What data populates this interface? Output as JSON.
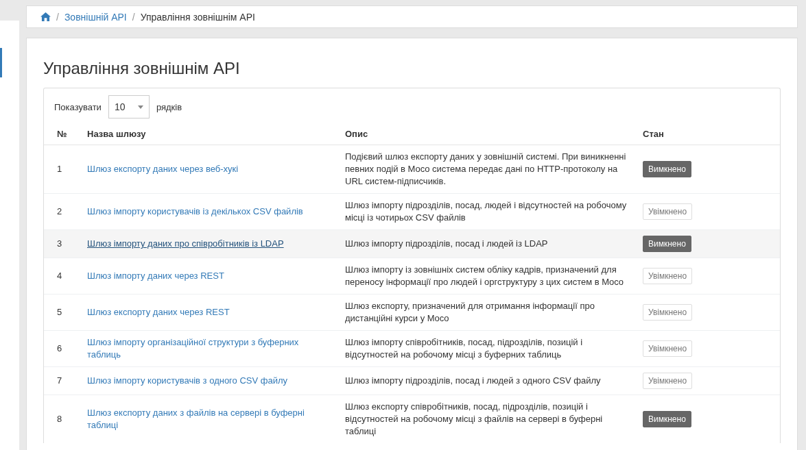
{
  "breadcrumb": [
    {
      "separator": "/",
      "label": "Зовнішній API",
      "link": true
    },
    {
      "separator": "/",
      "label": "Управління зовнішнім API",
      "link": false
    }
  ],
  "page_title": "Управління зовнішнім API",
  "page_size": {
    "label_before": "Показувати",
    "value": "10",
    "label_after": "рядків"
  },
  "table": {
    "columns": [
      "№",
      "Назва шлюзу",
      "Опис",
      "Стан"
    ],
    "rows": [
      {
        "number": "1",
        "name": "Шлюз експорту даних через веб-хукі",
        "description": "Подієвий шлюз експорту даних у зовнішній системі. При виникненні певних подій в Moco система передає дані по HTTP-протоколу на URL систем-підписчиків.",
        "status": "Вимкнено",
        "enabled": false,
        "highlighted": false
      },
      {
        "number": "2",
        "name": "Шлюз імпорту користувачів із декількох CSV файлів",
        "description": "Шлюз імпорту підрозділів, посад, людей і відсутностей на робочому місці із чотирьох CSV файлів",
        "status": "Увімкнено",
        "enabled": true,
        "highlighted": false
      },
      {
        "number": "3",
        "name": "Шлюз імпорту даних про співробітників із LDAP",
        "description": "Шлюз імпорту підрозділів, посад і людей із LDAP",
        "status": "Вимкнено",
        "enabled": false,
        "highlighted": true
      },
      {
        "number": "4",
        "name": "Шлюз імпорту даних через REST",
        "description": "Шлюз імпорту із зовнішніх систем обліку кадрів, призначений для переносу інформації про людей і оргструктуру з цих систем в Moco",
        "status": "Увімкнено",
        "enabled": true,
        "highlighted": false
      },
      {
        "number": "5",
        "name": "Шлюз експорту даних через REST",
        "description": "Шлюз експорту, призначений для отримання інформації про дистанційні курси у Moco",
        "status": "Увімкнено",
        "enabled": true,
        "highlighted": false
      },
      {
        "number": "6",
        "name": "Шлюз імпорту організаційної структури з буферних таблиць",
        "description": "Шлюз імпорту співробітників, посад, підрозділів, позицій і відсутностей на робочому місці з буферних таблиць",
        "status": "Увімкнено",
        "enabled": true,
        "highlighted": false
      },
      {
        "number": "7",
        "name": "Шлюз імпорту користувачів з одного CSV файлу",
        "description": "Шлюз імпорту підрозділів, посад і людей з одного CSV файлу",
        "status": "Увімкнено",
        "enabled": true,
        "highlighted": false
      },
      {
        "number": "8",
        "name": "Шлюз експорту даних з файлів на сервері в буферні таблиці",
        "description": "Шлюз експорту співробітників, посад, підрозділів, позицій і відсутностей на робочому місці з файлів на сервері в буферні таблиці",
        "status": "Вимкнено",
        "enabled": false,
        "highlighted": false
      }
    ]
  }
}
